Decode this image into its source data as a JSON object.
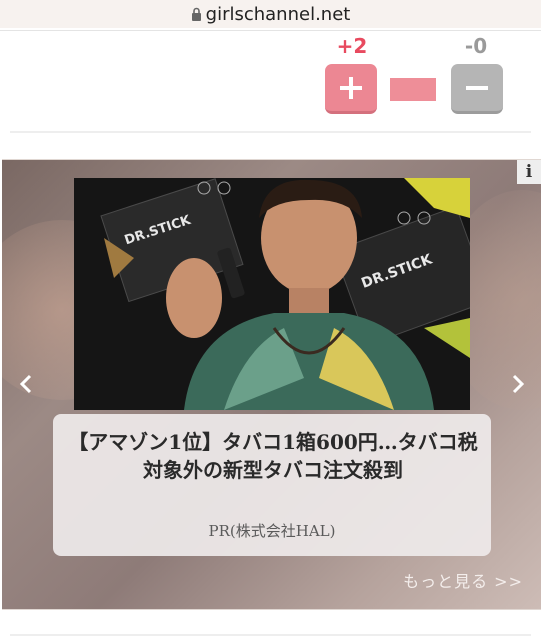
{
  "browser": {
    "url": "girlschannel.net",
    "lock_icon": "lock-icon"
  },
  "vote": {
    "plus_count": "+2",
    "minus_count": "-0",
    "plus_icon": "plus-icon",
    "minus_icon": "minus-icon",
    "plus_color": "#ec8793",
    "minus_color": "#b5b5b5",
    "plus_count_color": "#e84a5f",
    "minus_count_color": "#9a9a9a"
  },
  "ad": {
    "info_label": "i",
    "headline": "【アマゾン1位】タバコ1箱600円…タバコ税対象外の新型タバコ注文殺到",
    "sponsor": "PR(株式会社HAL)",
    "more_link": "もっと見る >>",
    "prev_icon": "chevron-left-icon",
    "next_icon": "chevron-right-icon",
    "photo_icon": "ad-photo",
    "product_labels": [
      "DR.STICK",
      "DR.STICK"
    ]
  }
}
